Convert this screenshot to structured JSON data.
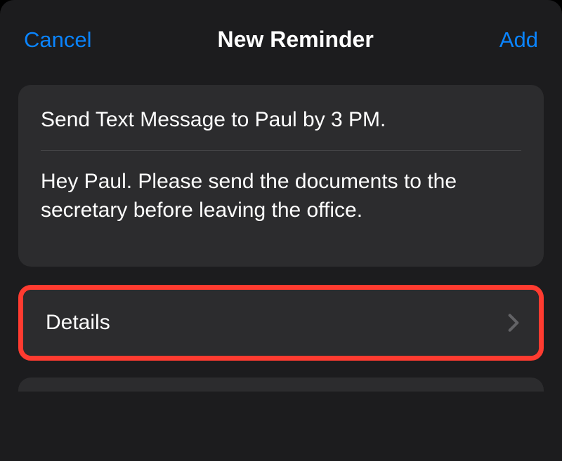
{
  "header": {
    "cancel": "Cancel",
    "title": "New Reminder",
    "add": "Add"
  },
  "reminder": {
    "title": "Send Text Message to Paul by 3 PM.",
    "notes": "Hey Paul. Please send the documents to the secretary before leaving the office."
  },
  "details": {
    "label": "Details"
  }
}
